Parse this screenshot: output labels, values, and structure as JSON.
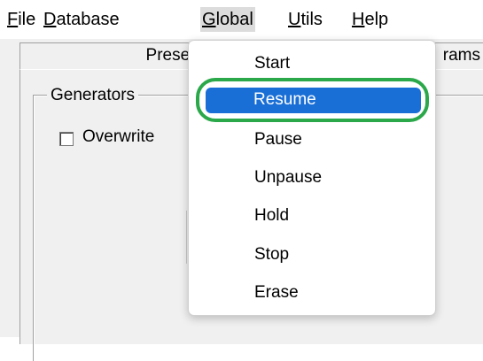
{
  "menubar": {
    "items": [
      {
        "accel": "F",
        "rest": "ile"
      },
      {
        "accel": "D",
        "rest": "atabase"
      },
      {
        "accel": "G",
        "rest": "lobal"
      },
      {
        "accel": "U",
        "rest": "tils"
      },
      {
        "accel": "H",
        "rest": "elp"
      }
    ]
  },
  "tabs": [
    {
      "label": "Preset"
    },
    {
      "label": "rams"
    }
  ],
  "groupbox": {
    "title": "Generators",
    "checkbox_label": "Overwrite"
  },
  "global_menu": {
    "items": [
      "Start",
      "Resume",
      "Pause",
      "Unpause",
      "Hold",
      "Stop",
      "Erase"
    ],
    "highlighted": "Resume"
  },
  "colors": {
    "highlight": "#1a6fd6",
    "annotation_ring": "#2aa84a"
  }
}
